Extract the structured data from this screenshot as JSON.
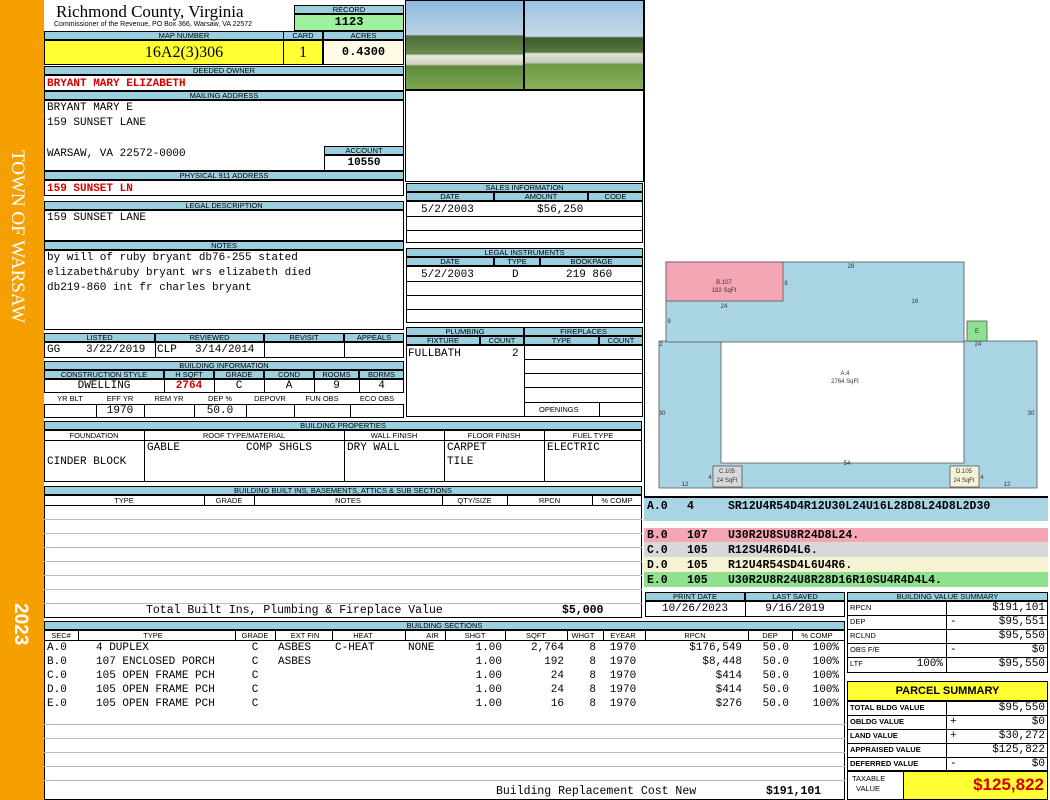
{
  "side": {
    "town": "TOWN OF WARSAW",
    "year": "2023"
  },
  "header": {
    "county": "Richmond County, Virginia",
    "commissioner": "Commissioner of the Revenue, PO Box 366, Warsaw, VA 22572",
    "record_label": "RECORD",
    "record": "1123",
    "map_label": "MAP NUMBER",
    "map": "16A2(3)306",
    "card_label": "CARD",
    "card": "1",
    "acres_label": "ACRES",
    "acres": "0.4300"
  },
  "owner": {
    "deeded_label": "DEEDED OWNER",
    "deeded": "BRYANT MARY ELIZABETH",
    "mailing_label": "MAILING ADDRESS",
    "line1": "BRYANT MARY E",
    "line2": "159  SUNSET LANE",
    "line3": "WARSAW, VA 22572-0000",
    "account_label": "ACCOUNT",
    "account": "10550",
    "phys_label": "PHYSICAL 911 ADDRESS",
    "phys": "159 SUNSET LN"
  },
  "legal": {
    "label": "LEGAL DESCRIPTION",
    "text": "159 SUNSET LANE"
  },
  "notes": {
    "label": "NOTES",
    "line1": "by will of ruby bryant db76-255 stated",
    "line2": "elizabeth&ruby bryant wrs elizabeth died",
    "line3": "db219-860 int fr charles bryant"
  },
  "listing": {
    "listed_label": "LISTED",
    "listed_by": "GG",
    "listed_date": "3/22/2019",
    "reviewed_label": "REVIEWED",
    "reviewed_by": "CLP",
    "reviewed_date": "3/14/2014",
    "revisit_label": "REVISIT",
    "appeals_label": "APPEALS"
  },
  "building_info": {
    "label": "BUILDING INFORMATION",
    "style_label": "CONSTRUCTION STYLE",
    "style": "DWELLING",
    "hsqft_label": "H SQFT",
    "hsqft": "2764",
    "grade_label": "GRADE",
    "grade": "C",
    "cond_label": "COND",
    "cond": "A",
    "rooms_label": "ROOMS",
    "rooms": "9",
    "bdrms_label": "BDRMS",
    "bdrms": "4",
    "yrblt_label": "YR BLT",
    "effyr_label": "EFF YR",
    "effyr": "1970",
    "remyr_label": "REM YR",
    "dep_label": "DEP %",
    "dep": "50.0",
    "depovr_label": "DEPOVR",
    "funobs_label": "FUN OBS",
    "ecoobs_label": "ECO OBS"
  },
  "sales": {
    "label": "SALES INFORMATION",
    "date_h": "DATE",
    "amount_h": "AMOUNT",
    "code_h": "CODE",
    "date": "5/2/2003",
    "amount": "$56,250"
  },
  "legal_inst": {
    "label": "LEGAL INSTRUMENTS",
    "date_h": "DATE",
    "type_h": "TYPE",
    "book_h": "BOOKPAGE",
    "date": "5/2/2003",
    "type": "D",
    "book": "219 860"
  },
  "plumbing": {
    "label": "PLUMBING",
    "fixture_h": "FIXTURE",
    "count_h": "COUNT",
    "fixture": "FULLBATH",
    "count": "2"
  },
  "fireplaces": {
    "label": "FIREPLACES",
    "type_h": "TYPE",
    "count_h": "COUNT",
    "openings": "OPENINGS"
  },
  "props": {
    "label": "BUILDING PROPERTIES",
    "foundation_h": "FOUNDATION",
    "roof_h": "ROOF TYPE/MATERIAL",
    "wall_h": "WALL FINISH",
    "floor_h": "FLOOR FINISH",
    "fuel_h": "FUEL TYPE",
    "foundation": "CINDER BLOCK",
    "roof1": "GABLE",
    "roof2": "COMP SHGLS",
    "wall": "DRY WALL",
    "floor1": "CARPET",
    "floor2": "TILE",
    "fuel": "ELECTRIC"
  },
  "builtins": {
    "label": "BUILDING BUILT INS, BASEMENTS, ATTICS & SUB SECTIONS",
    "type_h": "TYPE",
    "grade_h": "GRADE",
    "notes_h": "NOTES",
    "qty_h": "QTY/SIZE",
    "rpcn_h": "RPCN",
    "comp_h": "% COMP",
    "total_label": "Total Built Ins, Plumbing & Fireplace Value",
    "total": "$5,000"
  },
  "sketch": {
    "rects": [
      {
        "label": "B.107",
        "sub": "192 SqFt",
        "color": "#f4a6b5"
      },
      {
        "label": "A.4",
        "sub": "2764 SqFt",
        "color": "#a9d4e4"
      },
      {
        "label": "E",
        "sub": "",
        "color": "#8fe08f"
      },
      {
        "label": "C.105",
        "sub": "24 SqFt",
        "color": "#d8d8d8"
      },
      {
        "label": "D.105",
        "sub": "24 SqFt",
        "color": "#f6f3d4"
      }
    ],
    "dims": [
      "28",
      "8",
      "24",
      "16",
      "9",
      "2",
      "24",
      "30",
      "30",
      "54",
      "12",
      "12",
      "4",
      "4"
    ]
  },
  "vectors": [
    {
      "code": "A.0",
      "num": "4",
      "vec": "SR12U4R54D4R12U30L24U16L28D8L24D8L2D30",
      "color": "#a9d4e4"
    },
    {
      "code": "B.0",
      "num": "107",
      "vec": "U30R2U8SU8R24D8L24.",
      "color": "#f4a6b5"
    },
    {
      "code": "C.0",
      "num": "105",
      "vec": "R12SU4R6D4L6.",
      "color": "#d8d8d8"
    },
    {
      "code": "D.0",
      "num": "105",
      "vec": "R12U4R54SD4L6U4R6.",
      "color": "#f6f3d4"
    },
    {
      "code": "E.0",
      "num": "105",
      "vec": "U30R2U8R24U8R28D16R10SU4R4D4L4.",
      "color": "#8fe08f"
    }
  ],
  "dates": {
    "print_label": "PRINT DATE",
    "print": "10/26/2023",
    "saved_label": "LAST SAVED",
    "saved": "9/16/2019"
  },
  "sections": {
    "label": "BUILDING SECTIONS",
    "headers": [
      "SEC#",
      "TYPE",
      "GRADE",
      "EXT FIN",
      "HEAT",
      "AIR",
      "SHGT",
      "SQFT",
      "WHGT",
      "EYEAR",
      "RPCN",
      "DEP",
      "% COMP"
    ],
    "rows": [
      [
        "A.0",
        "4 DUPLEX",
        "C",
        "ASBES",
        "C-HEAT",
        "NONE",
        "1.00",
        "2,764",
        "8",
        "1970",
        "$176,549",
        "50.0",
        "100%"
      ],
      [
        "B.0",
        "107 ENCLOSED PORCH",
        "C",
        "ASBES",
        "",
        "",
        "1.00",
        "192",
        "8",
        "1970",
        "$8,448",
        "50.0",
        "100%"
      ],
      [
        "C.0",
        "105 OPEN FRAME PCH",
        "C",
        "",
        "",
        "",
        "1.00",
        "24",
        "8",
        "1970",
        "$414",
        "50.0",
        "100%"
      ],
      [
        "D.0",
        "105 OPEN FRAME PCH",
        "C",
        "",
        "",
        "",
        "1.00",
        "24",
        "8",
        "1970",
        "$414",
        "50.0",
        "100%"
      ],
      [
        "E.0",
        "105 OPEN FRAME PCH",
        "C",
        "",
        "",
        "",
        "1.00",
        "16",
        "8",
        "1970",
        "$276",
        "50.0",
        "100%"
      ]
    ],
    "replacement_label": "Building Replacement Cost New",
    "replacement": "$191,101"
  },
  "value_summary": {
    "label": "BUILDING VALUE SUMMARY",
    "rows": [
      {
        "label": "RPCN",
        "sign": "",
        "pct": "",
        "value": "$191,101"
      },
      {
        "label": "DEP",
        "sign": "-",
        "pct": "",
        "value": "$95,551"
      },
      {
        "label": "RCLND",
        "sign": "",
        "pct": "",
        "value": "$95,550"
      },
      {
        "label": "OBS F/E",
        "sign": "-",
        "pct": "",
        "value": "$0"
      },
      {
        "label": "LTF",
        "sign": "",
        "pct": "100%",
        "value": "$95,550"
      }
    ]
  },
  "parcel": {
    "label": "PARCEL SUMMARY",
    "rows": [
      {
        "label": "TOTAL BLDG VALUE",
        "sign": "",
        "value": "$95,550"
      },
      {
        "label": "OBLDG VALUE",
        "sign": "+",
        "value": "$0"
      },
      {
        "label": "LAND VALUE",
        "sign": "+",
        "value": "$30,272"
      },
      {
        "label": "APPRAISED VALUE",
        "sign": "",
        "value": "$125,822"
      },
      {
        "label": "DEFERRED VALUE",
        "sign": "-",
        "value": "$0"
      }
    ],
    "taxable_label1": "TAXABLE",
    "taxable_label2": "VALUE",
    "taxable": "$125,822"
  }
}
